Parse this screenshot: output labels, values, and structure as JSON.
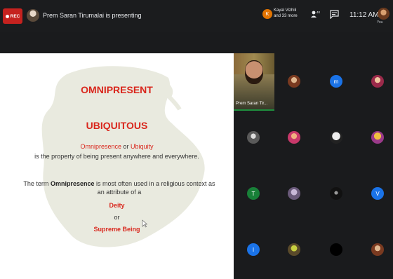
{
  "topbar": {
    "rec_label": "REC",
    "presenting_text": "Prem Saran Tirumalai is presenting",
    "participant_initial": "K",
    "participants_line1": "Kayal Vizhili",
    "participants_line2": "and 33 more",
    "people_count": "40",
    "clock": "11:12 AM",
    "self_label": "You"
  },
  "slide": {
    "title1": "OMNIPRESENT",
    "title2": "UBIQUITOUS",
    "line1_a": "Omnipresence",
    "line1_b": " or ",
    "line1_c": "Ubiquity",
    "line2": "is the property of being present anywhere and everywhere.",
    "line3_a": "The term ",
    "line3_b": "Omnipresence",
    "line3_c": " is most often used in a religious context as an attribute of a",
    "deity": "Deity",
    "or": "or",
    "supreme": "Supreme Being"
  },
  "grid": {
    "video_label": "Prem Saran Tir...",
    "tiles": [
      {
        "letter": "",
        "color": "#ffffff"
      },
      {
        "letter": "m",
        "color": "#1a73e8"
      },
      {
        "letter": "",
        "color": "#ffffff"
      },
      {
        "letter": "",
        "color": "#ffffff"
      },
      {
        "letter": "",
        "color": "#ffffff"
      },
      {
        "letter": "",
        "color": "#ffffff"
      },
      {
        "letter": "",
        "color": "#ffffff"
      },
      {
        "letter": "T",
        "color": "#188038"
      },
      {
        "letter": "",
        "color": "#ffffff"
      },
      {
        "letter": "",
        "color": "#ffffff"
      },
      {
        "letter": "V",
        "color": "#1a73e8"
      },
      {
        "letter": "I",
        "color": "#1a73e8"
      },
      {
        "letter": "",
        "color": "#ffffff"
      },
      {
        "letter": "",
        "color": "#ffffff"
      },
      {
        "letter": "",
        "color": "#ffffff"
      }
    ]
  },
  "colors": {
    "accent_red": "#d9261c",
    "rec_red": "#c5221f",
    "speaking_green": "#1e8e3e"
  }
}
